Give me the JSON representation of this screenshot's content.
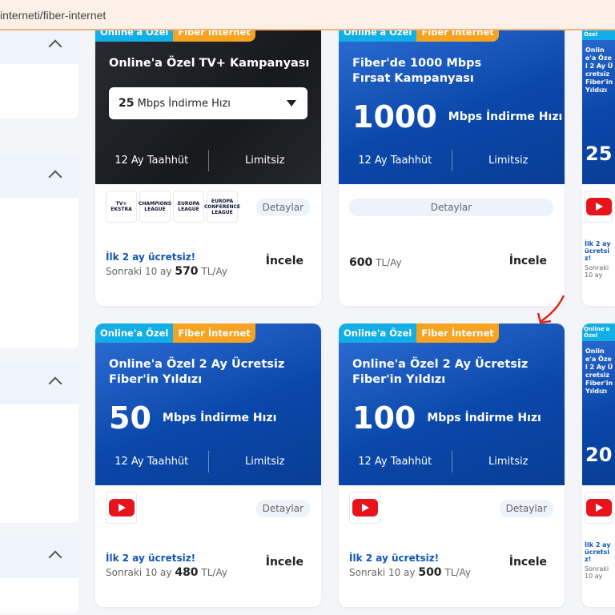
{
  "url": "interneti/fiber-internet",
  "badges": {
    "online": "Online'a Özel",
    "fiber": "Fiber İnternet"
  },
  "common": {
    "commitment": "12 Ay Taahhüt",
    "limit": "Limitsiz",
    "details": "Detaylar",
    "review": "İncele",
    "free": "İlk 2 ay ücretsiz!",
    "next": "Sonraki 10 ay",
    "unit": "TL/Ay",
    "speed_unit": "Mbps İndirme Hızı"
  },
  "cards": [
    {
      "title": "Online'a Özel TV+ Kampanyası",
      "dropdown_value": "25",
      "dropdown_label": "Mbps İndirme Hızı",
      "price": "570",
      "icons": [
        "TV+ EKSTRA",
        "CHAMPIONS LEAGUE",
        "EUROPA LEAGUE",
        "EUROPA CONFERENCE LEAGUE"
      ]
    },
    {
      "title": "Fiber'de 1000 Mbps Fırsat Kampanyası",
      "speed": "1000",
      "price": "600"
    },
    {
      "title": "Online'a Özel 2 Ay Ücretsiz Fiber'in Yıldızı",
      "speed": "25"
    },
    {
      "title": "Online'a Özel 2 Ay Ücretsiz Fiber'in Yıldızı",
      "speed": "50",
      "price": "480"
    },
    {
      "title": "Online'a Özel 2 Ay Ücretsiz Fiber'in Yıldızı",
      "speed": "100",
      "price": "500"
    },
    {
      "title": "Online'a Özel 2 Ay Ücretsiz Fiber'in Yıldızı",
      "speed": "20"
    }
  ],
  "colors": {
    "blue": "#0b48ab",
    "cyan_badge": "#12aee6",
    "orange_badge": "#f5a320",
    "annotation": "#d9261c"
  }
}
